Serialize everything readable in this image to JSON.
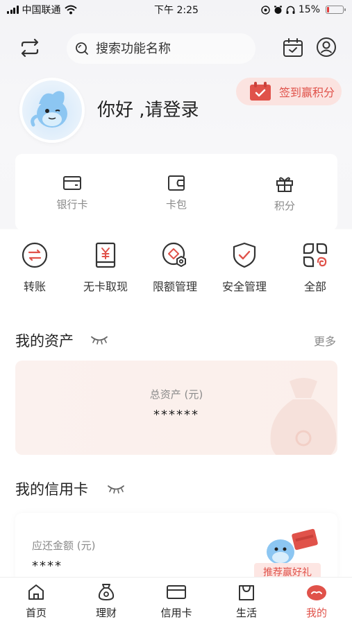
{
  "status_bar": {
    "carrier": "中国联通",
    "time": "下午 2:25",
    "battery": "15%",
    "battery_level": 0.15
  },
  "header": {
    "search_placeholder": "搜索功能名称"
  },
  "profile": {
    "greeting": "你好 ,请登录",
    "signin_button": "签到赢积分"
  },
  "cards": [
    {
      "label": "银行卡",
      "icon": "wallet-icon"
    },
    {
      "label": "卡包",
      "icon": "card-pack-icon"
    },
    {
      "label": "积分",
      "icon": "gift-icon"
    }
  ],
  "quick_actions": [
    {
      "label": "转账",
      "icon": "transfer-icon"
    },
    {
      "label": "无卡取现",
      "icon": "cardless-withdraw-icon"
    },
    {
      "label": "限额管理",
      "icon": "limit-manage-icon"
    },
    {
      "label": "安全管理",
      "icon": "shield-check-icon"
    },
    {
      "label": "全部",
      "icon": "all-apps-icon"
    }
  ],
  "assets": {
    "title": "我的资产",
    "more": "更多",
    "total_label": "总资产 (元)",
    "total_value": "******"
  },
  "credit": {
    "title": "我的信用卡",
    "due_label": "应还金额 (元)",
    "due_value": "****",
    "recommend_tag": "推荐赢好礼"
  },
  "tabs": [
    {
      "label": "首页",
      "icon": "home-icon"
    },
    {
      "label": "理财",
      "icon": "wealth-icon"
    },
    {
      "label": "信用卡",
      "icon": "credit-card-icon"
    },
    {
      "label": "生活",
      "icon": "shopping-bag-icon"
    },
    {
      "label": "我的",
      "icon": "mine-icon",
      "active": true
    }
  ],
  "colors": {
    "accent": "#e0524a",
    "signin_bg": "#fbe3e0",
    "asset_card_bg": "#fbf1ee"
  }
}
